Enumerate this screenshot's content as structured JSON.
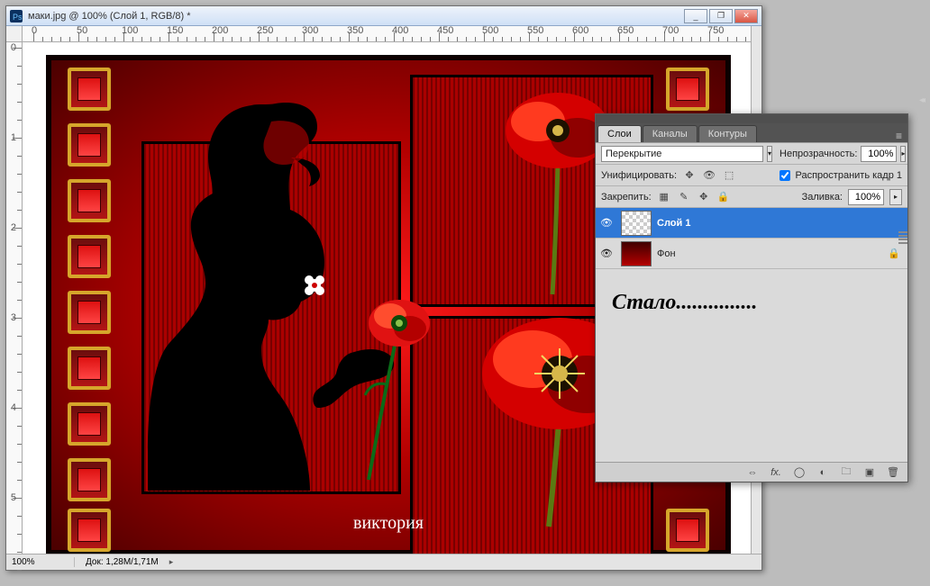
{
  "window": {
    "title": "маки.jpg @ 100% (Слой 1, RGB/8) *",
    "zoom": "100%",
    "doc_size": "Док: 1,28M/1,71M",
    "win_buttons": {
      "min": "_",
      "max": "❐",
      "close": "✕"
    }
  },
  "ruler": {
    "h_labels": [
      "0",
      "50",
      "100",
      "150",
      "200",
      "250",
      "300",
      "350",
      "400",
      "450",
      "500",
      "550",
      "600",
      "650",
      "700",
      "750"
    ],
    "v_labels": [
      "0",
      "1",
      "2",
      "3",
      "4",
      "5"
    ]
  },
  "artwork": {
    "signature": "виктория"
  },
  "panel": {
    "tabs": {
      "layers": "Слои",
      "channels": "Каналы",
      "paths": "Контуры"
    },
    "blend_mode_label": "",
    "blend_mode_value": "Перекрытие",
    "opacity_label": "Непрозрачность:",
    "opacity_value": "100%",
    "unify_label": "Унифицировать:",
    "propagate_label": "Распространить кадр 1",
    "lock_label": "Закрепить:",
    "fill_label": "Заливка:",
    "fill_value": "100%",
    "layers": [
      {
        "name": "Слой 1",
        "selected": true,
        "thumb": "checker",
        "locked": false
      },
      {
        "name": "Фон",
        "selected": false,
        "thumb": "red",
        "locked": true
      }
    ],
    "annotation": "Стало...............",
    "footer_icons": [
      "link",
      "fx",
      "mask",
      "adjust",
      "group",
      "new",
      "trash"
    ]
  },
  "icons": {
    "eye": "👁",
    "lock": "🔒",
    "link": "⇔",
    "fx": "fx.",
    "mask": "◯",
    "adjust": "◐",
    "group": "🗀",
    "new": "▣",
    "trash": "🗑",
    "menu": "≡",
    "tri": "▸",
    "tridown": "▾"
  }
}
